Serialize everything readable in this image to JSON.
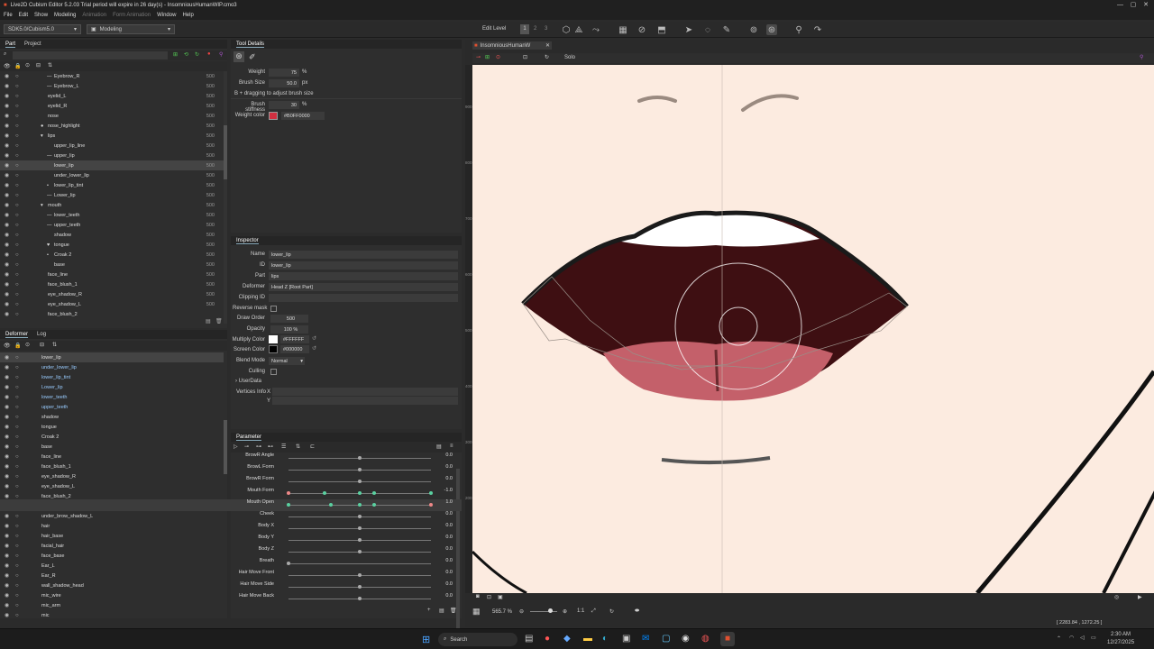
{
  "app": {
    "title": "Live2D Cubism Editor 5.2.03   Trial period will expire in 26 day(s)  - InsomniousHumanWIP.cmo3"
  },
  "menu": [
    "File",
    "Edit",
    "Show",
    "Modeling",
    "Animation",
    "Form Animation",
    "Window",
    "Help"
  ],
  "toolbar": {
    "sdk": "SDK5.0/Cubism5.0",
    "mode": "Modeling",
    "edit_level": "Edit Level",
    "level_1": "1",
    "level_2": "2",
    "level_3": "3"
  },
  "part_panel": {
    "tabs": [
      "Part",
      "Project"
    ],
    "rows": [
      {
        "name": "Eyebrow_R",
        "val": "500",
        "indent": 60,
        "icon": "—"
      },
      {
        "name": "Eyebrow_L",
        "val": "500",
        "indent": 60,
        "icon": "—"
      },
      {
        "name": "eyelid_L",
        "val": "500",
        "indent": 53,
        "icon": ""
      },
      {
        "name": "eyelid_R",
        "val": "500",
        "indent": 53,
        "icon": ""
      },
      {
        "name": "nose",
        "val": "500",
        "indent": 53,
        "icon": ""
      },
      {
        "name": "nose_highlight",
        "val": "500",
        "indent": 53,
        "icon": "●"
      },
      {
        "name": "lips",
        "val": "500",
        "indent": 53,
        "icon": "▾"
      },
      {
        "name": "upper_lip_line",
        "val": "500",
        "indent": 60,
        "icon": ""
      },
      {
        "name": "upper_lip",
        "val": "500",
        "indent": 60,
        "icon": "—"
      },
      {
        "name": "lower_lip",
        "val": "500",
        "indent": 60,
        "icon": ""
      },
      {
        "name": "under_lower_lip",
        "val": "500",
        "indent": 60,
        "icon": ""
      },
      {
        "name": "lower_lip_tint",
        "val": "500",
        "indent": 60,
        "icon": "•"
      },
      {
        "name": "Lower_lip",
        "val": "500",
        "indent": 60,
        "icon": "—"
      },
      {
        "name": "mouth",
        "val": "500",
        "indent": 53,
        "icon": "▾"
      },
      {
        "name": "lower_teeth",
        "val": "500",
        "indent": 60,
        "icon": "—"
      },
      {
        "name": "upper_teeth",
        "val": "500",
        "indent": 60,
        "icon": "—"
      },
      {
        "name": "shadow",
        "val": "500",
        "indent": 60,
        "icon": ""
      },
      {
        "name": "tongue",
        "val": "500",
        "indent": 60,
        "icon": "♥"
      },
      {
        "name": "Croak 2",
        "val": "500",
        "indent": 60,
        "icon": "•"
      },
      {
        "name": "base",
        "val": "500",
        "indent": 60,
        "icon": ""
      },
      {
        "name": "face_line",
        "val": "500",
        "indent": 53,
        "icon": ""
      },
      {
        "name": "face_blush_1",
        "val": "500",
        "indent": 53,
        "icon": ""
      },
      {
        "name": "eye_shadow_R",
        "val": "500",
        "indent": 53,
        "icon": ""
      },
      {
        "name": "eye_shadow_L",
        "val": "500",
        "indent": 53,
        "icon": ""
      },
      {
        "name": "face_blush_2",
        "val": "",
        "indent": 53,
        "icon": ""
      }
    ]
  },
  "deformer_panel": {
    "tabs": [
      "Deformer",
      "Log"
    ],
    "rows": [
      "lower_lip",
      "under_lower_lip",
      "lower_lip_tint",
      "Lower_lip",
      "lower_teeth",
      "upper_teeth",
      "shadow",
      "tongue",
      "Croak 2",
      "base",
      "face_line",
      "face_blush_1",
      "eye_shadow_R",
      "eye_shadow_L",
      "face_blush_2",
      "under_brow_shadow_R",
      "under_brow_shadow_L",
      "hair",
      "hair_base",
      "facial_hair",
      "face_base",
      "Ear_L",
      "Ear_R",
      "wall_shadow_head",
      "mic_wire",
      "mic_arm",
      "mic"
    ]
  },
  "tool_details": {
    "title": "Tool Details",
    "weight_label": "Weight",
    "weight_val": "75",
    "weight_unit": "%",
    "brush_label": "Brush Size",
    "brush_val": "50.0",
    "brush_unit": "px",
    "hint": "B + dragging to adjust brush size",
    "stiff_label": "Brush stiffness",
    "stiff_val": "30",
    "stiff_unit": "%",
    "color_label": "Weight color",
    "color_val": "#B0FF0000"
  },
  "inspector": {
    "title": "Inspector",
    "rows": [
      {
        "label": "Name",
        "value": "lower_lip"
      },
      {
        "label": "ID",
        "value": "lower_lip"
      },
      {
        "label": "Part",
        "value": "lips"
      },
      {
        "label": "Deformer",
        "value": "Head Z  [Root Part]"
      },
      {
        "label": "Clipping ID",
        "value": ""
      }
    ],
    "reverse_mask": "Reverse mask",
    "draw_order_label": "Draw Order",
    "draw_order": "500",
    "opacity_label": "Opacity",
    "opacity": "100 %",
    "multiply_label": "Multiply Color",
    "multiply": "#FFFFFF",
    "screen_label": "Screen Color",
    "screen": "#000000",
    "blend_label": "Blend Mode",
    "blend": "Normal",
    "culling": "Culling",
    "userdata": "UserData",
    "vertices": "Vertices Info",
    "vx": "X",
    "vy": "Y"
  },
  "parameters": {
    "title": "Parameter",
    "rows": [
      {
        "name": "BrowR Angle",
        "val": "0.0",
        "knob": 0.5,
        "keys": []
      },
      {
        "name": "BrowL Form",
        "val": "0.0",
        "knob": 0.5,
        "keys": []
      },
      {
        "name": "BrowR Form",
        "val": "0.0",
        "knob": 0.5,
        "keys": []
      },
      {
        "name": "Mouth Form",
        "val": "-1.0",
        "knob": 0.0,
        "keys": [
          0.25,
          0.5,
          0.6,
          1.0
        ]
      },
      {
        "name": "Mouth Open",
        "val": "1.0",
        "knob": 1.0,
        "keys": [
          0.0,
          0.3,
          0.5,
          0.6
        ]
      },
      {
        "name": "Cheek",
        "val": "0.0",
        "knob": 0.5,
        "keys": []
      },
      {
        "name": "Body X",
        "val": "0.0",
        "knob": 0.5,
        "keys": []
      },
      {
        "name": "Body Y",
        "val": "0.0",
        "knob": 0.5,
        "keys": []
      },
      {
        "name": "Body Z",
        "val": "0.0",
        "knob": 0.5,
        "keys": []
      },
      {
        "name": "Breath",
        "val": "0.0",
        "knob": 0.0,
        "keys": []
      },
      {
        "name": "Hair Move Front",
        "val": "0.0",
        "knob": 0.5,
        "keys": []
      },
      {
        "name": "Hair Move Side",
        "val": "0.0",
        "knob": 0.5,
        "keys": []
      },
      {
        "name": "Hair Move Back",
        "val": "0.0",
        "knob": 0.5,
        "keys": []
      }
    ]
  },
  "canvas": {
    "tab": "InsomniousHumanW",
    "solo": "Solo",
    "zoom": "565.7 %",
    "coords": "[ 2283.84 , 1272.25 ]",
    "ruler": [
      "900",
      "800",
      "700",
      "600",
      "500",
      "400",
      "300",
      "200"
    ]
  },
  "taskbar": {
    "search": "Search",
    "time": "2:30 AM",
    "date": "12/27/2025"
  }
}
